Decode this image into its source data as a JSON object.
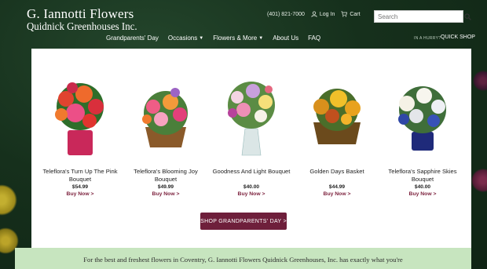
{
  "logo": {
    "line1": "G. Iannotti Flowers",
    "line2": "Quidnick Greenhouses Inc."
  },
  "utility": {
    "phone": "(401) 821-7000",
    "login": "Log In",
    "cart": "Cart"
  },
  "search": {
    "placeholder": "Search"
  },
  "nav": {
    "items": [
      {
        "label": "Grandparents' Day",
        "dropdown": false
      },
      {
        "label": "Occasions",
        "dropdown": true
      },
      {
        "label": "Flowers & More",
        "dropdown": true
      },
      {
        "label": "About Us",
        "dropdown": false
      },
      {
        "label": "FAQ",
        "dropdown": false
      }
    ],
    "hurry": "IN A HURRY?",
    "quick_shop": "QUICK SHOP"
  },
  "products": [
    {
      "name": "Teleflora's Turn Up The Pink Bouquet",
      "price": "$54.99",
      "buy": "Buy Now >"
    },
    {
      "name": "Teleflora's Blooming Joy Bouquet",
      "price": "$49.99",
      "buy": "Buy Now >"
    },
    {
      "name": "Goodness And Light Bouquet",
      "price": "$40.00",
      "buy": "Buy Now >"
    },
    {
      "name": "Golden Days Basket",
      "price": "$44.99",
      "buy": "Buy Now >"
    },
    {
      "name": "Teleflora's Sapphire Skies Bouquet",
      "price": "$40.00",
      "buy": "Buy Now >"
    }
  ],
  "shop_button": "SHOP GRANDPARENTS' DAY >",
  "intro_text": "For the best and freshest flowers in Coventry, G. Iannotti Flowers Quidnick Greenhouses, Inc. has exactly what you're",
  "colors": {
    "accent": "#6e1f3b",
    "intro_bg": "#c7e5bf",
    "header_bg": "#1a3620"
  }
}
